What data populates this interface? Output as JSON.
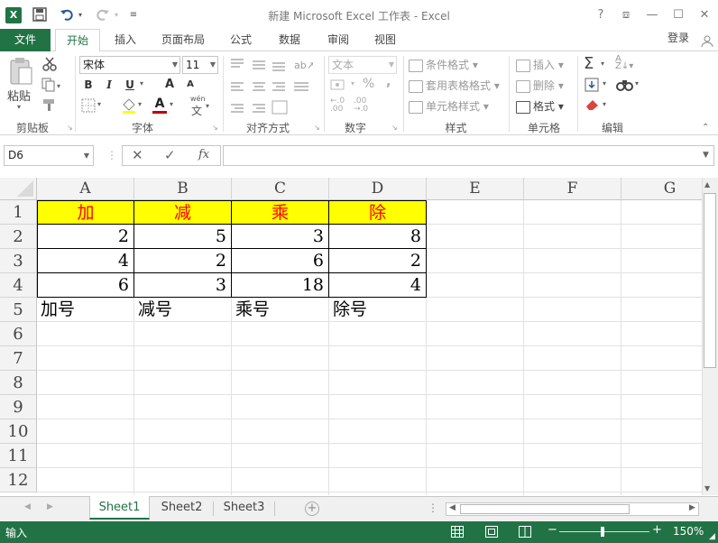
{
  "window": {
    "title": "新建 Microsoft Excel 工作表 - Excel",
    "help": "?",
    "restore_ribbon": "⧈",
    "minimize": "—",
    "maximize": "☐",
    "close": "✕"
  },
  "qat": {
    "save_icon": "save-icon",
    "undo_icon": "undo-icon",
    "redo_icon": "redo-icon",
    "customize_icon": "customize-icon"
  },
  "tabs": [
    {
      "label": "文件"
    },
    {
      "label": "开始"
    },
    {
      "label": "插入"
    },
    {
      "label": "页面布局"
    },
    {
      "label": "公式"
    },
    {
      "label": "数据"
    },
    {
      "label": "审阅"
    },
    {
      "label": "视图"
    }
  ],
  "user": {
    "login_label": "登录"
  },
  "ribbon": {
    "clipboard": {
      "paste_label": "粘贴",
      "group_label": "剪贴板"
    },
    "font": {
      "font_name": "宋体",
      "font_size": "11",
      "group_label": "字体",
      "bold": "B",
      "italic": "I",
      "underline": "U",
      "grow": "A",
      "shrink": "A",
      "font_color": "A",
      "phonetic": "wén"
    },
    "alignment": {
      "group_label": "对齐方式"
    },
    "number": {
      "format": "文本",
      "percent": "%",
      "comma": ",",
      "group_label": "数字"
    },
    "styles": {
      "conditional": "条件格式",
      "table": "套用表格格式",
      "cell_styles": "单元格样式",
      "group_label": "样式"
    },
    "cells": {
      "insert": "插入",
      "delete": "删除",
      "format": "格式",
      "group_label": "单元格"
    },
    "editing": {
      "sum": "Σ",
      "group_label": "编辑"
    }
  },
  "formula_bar": {
    "name_box": "D6",
    "fx": "fx",
    "cancel": "✕",
    "enter": "✓",
    "value": ""
  },
  "grid": {
    "columns": [
      "A",
      "B",
      "C",
      "D",
      "E",
      "F",
      "G"
    ],
    "rows": [
      "1",
      "2",
      "3",
      "4",
      "5",
      "6",
      "7",
      "8",
      "9",
      "10",
      "11",
      "12"
    ],
    "header_row": [
      "加",
      "减",
      "乘",
      "除"
    ],
    "data": [
      [
        "2",
        "5",
        "3",
        "8"
      ],
      [
        "4",
        "2",
        "6",
        "2"
      ],
      [
        "6",
        "3",
        "18",
        "4"
      ]
    ],
    "label_row": [
      "加号",
      "减号",
      "乘号",
      "除号"
    ]
  },
  "sheets": [
    {
      "label": "Sheet1"
    },
    {
      "label": "Sheet2"
    },
    {
      "label": "Sheet3"
    }
  ],
  "status": {
    "mode": "输入",
    "zoom": "150%",
    "zoom_minus": "−",
    "zoom_plus": "+"
  },
  "colors": {
    "accent": "#217346",
    "header_fill": "#ffff00",
    "header_text": "#ff0000"
  }
}
